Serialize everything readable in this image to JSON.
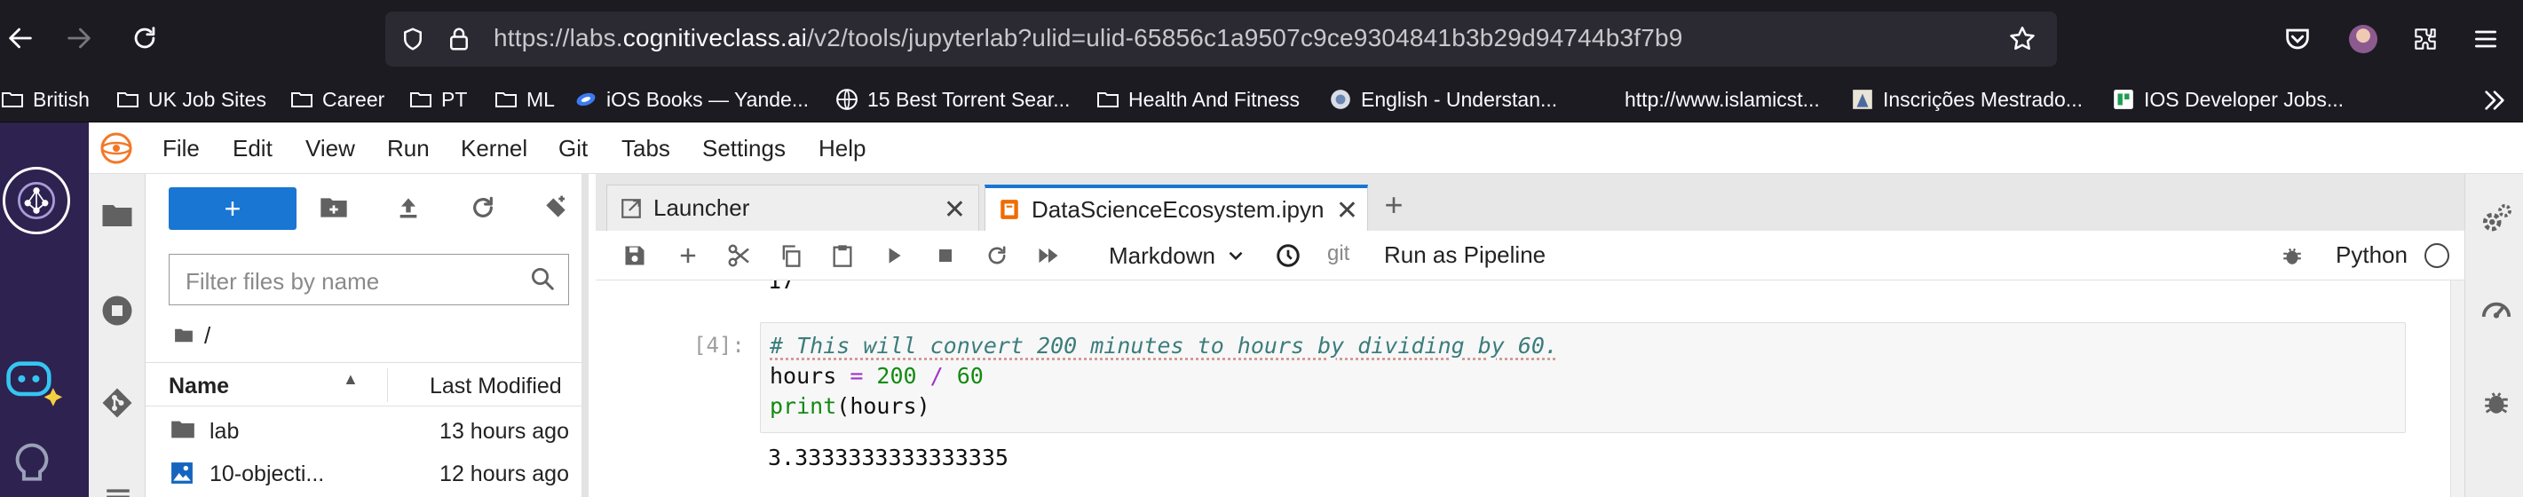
{
  "browser": {
    "url": {
      "prefix": "https://labs.",
      "domain": "cognitiveclass.ai",
      "path": "/v2/tools/jupyterlab?ulid=ulid-65856c1a9507c9ce9304841b3b29d94744b3f7b9"
    },
    "bookmarks": [
      {
        "label": "British",
        "icon": "folder-icon"
      },
      {
        "label": "UK Job Sites",
        "icon": "folder-icon"
      },
      {
        "label": "Career",
        "icon": "folder-icon"
      },
      {
        "label": "PT",
        "icon": "folder-icon"
      },
      {
        "label": "ML",
        "icon": "folder-icon"
      },
      {
        "label": "iOS Books — Yande...",
        "icon": "globe-blue-icon"
      },
      {
        "label": "15 Best Torrent Sear...",
        "icon": "globe-icon"
      },
      {
        "label": "Health And Fitness",
        "icon": "folder-icon"
      },
      {
        "label": "English - Understan...",
        "icon": "site-icon"
      },
      {
        "label": "http://www.islamicst...",
        "icon": "none"
      },
      {
        "label": "Inscrições Mestrado...",
        "icon": "site-icon"
      },
      {
        "label": "IOS Developer Jobs...",
        "icon": "site-icon"
      }
    ]
  },
  "jupyter": {
    "menu": [
      "File",
      "Edit",
      "View",
      "Run",
      "Kernel",
      "Git",
      "Tabs",
      "Settings",
      "Help"
    ],
    "filebrowser": {
      "new_label": "+",
      "filter_placeholder": "Filter files by name",
      "path": "/",
      "columns": {
        "name": "Name",
        "modified": "Last Modified"
      },
      "items": [
        {
          "name": "lab",
          "modified": "13 hours ago",
          "type": "folder"
        },
        {
          "name": "10-objecti...",
          "modified": "12 hours ago",
          "type": "image"
        }
      ]
    },
    "tabs": [
      {
        "label": "Launcher",
        "active": false
      },
      {
        "label": "DataScienceEcosystem.ipyn",
        "active": true
      }
    ],
    "toolbar": {
      "cell_type": "Markdown",
      "git": "git",
      "run_pipeline": "Run as Pipeline",
      "kernel": "Python"
    },
    "notebook": {
      "prev_output_fragment": "17",
      "cell_prompt": "[4]:",
      "code": {
        "comment": "# This will convert 200 minutes to hours by dividing by 60.",
        "l2_var": "hours ",
        "l2_eq": "=",
        "l2_num1": " 200 ",
        "l2_div": "/",
        "l2_num2": " 60",
        "l3_fn": "print",
        "l3_args": "(hours)"
      },
      "output": "3.3333333333333335"
    }
  },
  "colors": {
    "chrome_bg": "#1c1b22",
    "urlfield_bg": "#2b2a33",
    "jupyter_sidebar": "#2d2250",
    "accent_blue": "#1976d2",
    "tab_active_border": "#1976d2"
  }
}
